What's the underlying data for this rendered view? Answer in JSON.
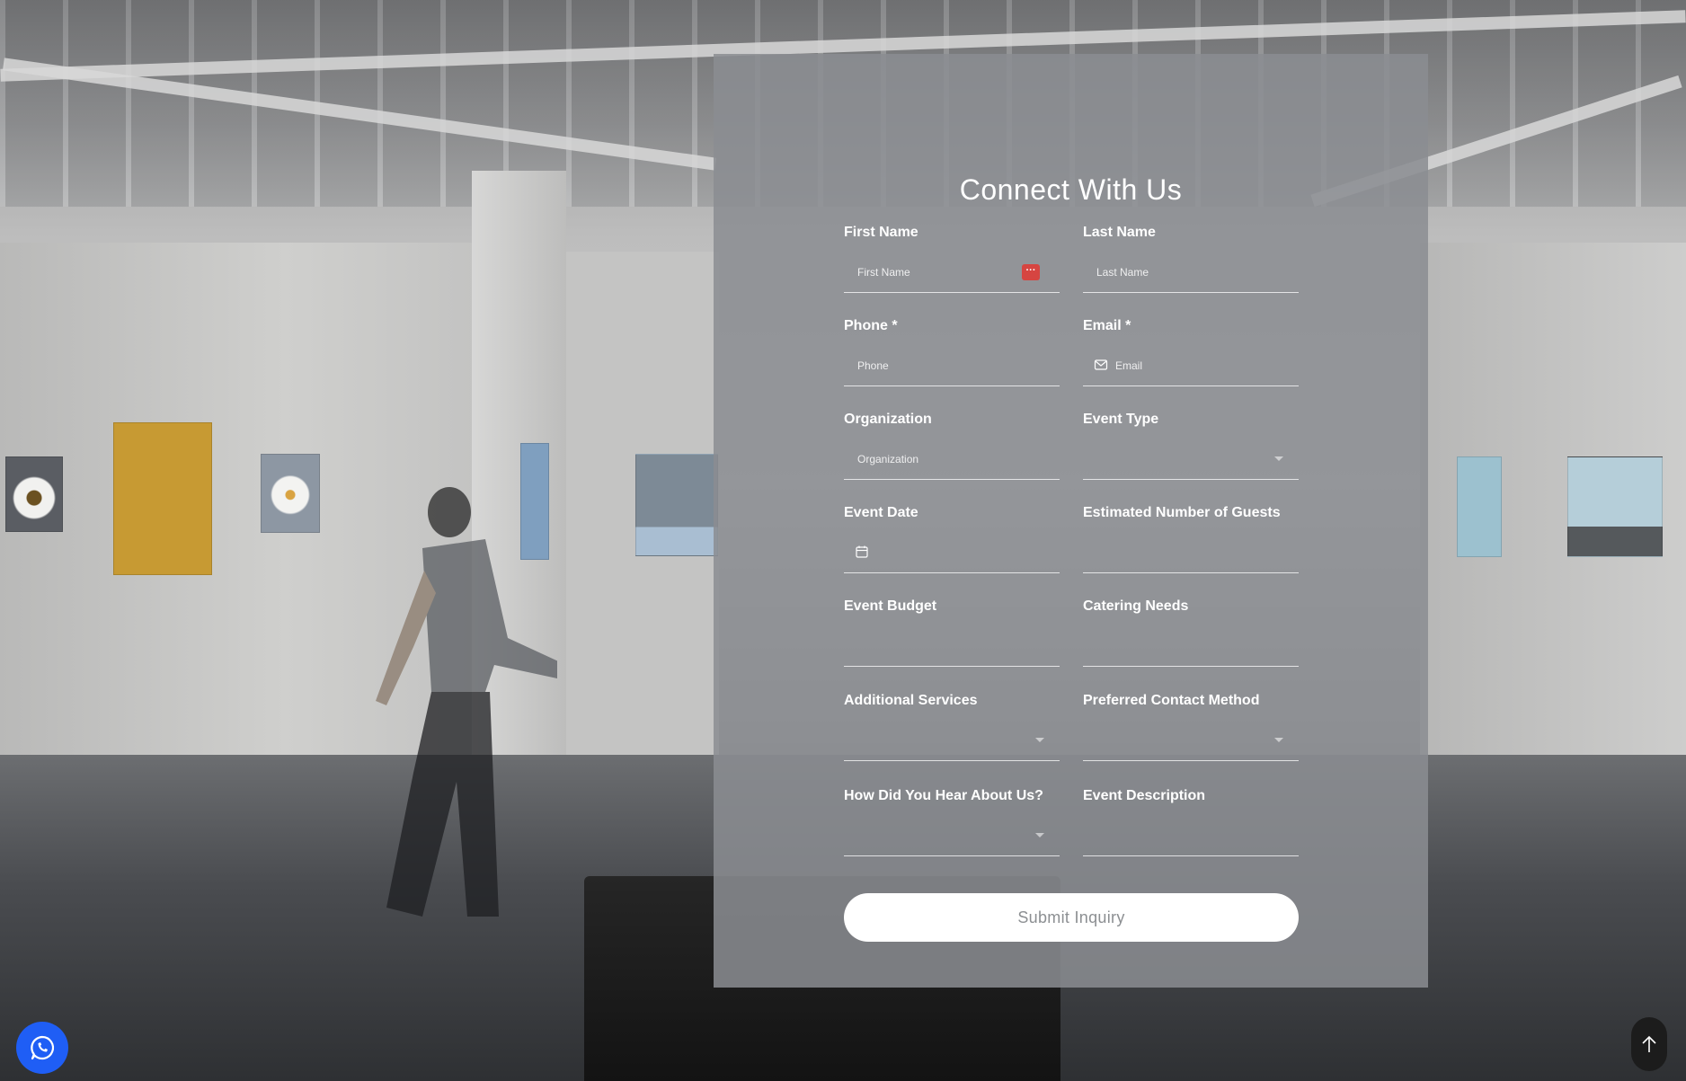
{
  "form": {
    "title": "Connect With Us",
    "fields": {
      "first_name": {
        "label": "First Name",
        "placeholder": "First Name"
      },
      "last_name": {
        "label": "Last Name",
        "placeholder": "Last Name"
      },
      "phone": {
        "label": "Phone *",
        "placeholder": "Phone"
      },
      "email": {
        "label": "Email *",
        "placeholder": "Email",
        "icon": "mail-icon"
      },
      "organization": {
        "label": "Organization",
        "placeholder": "Organization"
      },
      "event_type": {
        "label": "Event Type",
        "icon": "chevron-down-icon"
      },
      "event_date": {
        "label": "Event Date",
        "icon": "calendar-icon"
      },
      "guests": {
        "label": "Estimated Number of Guests"
      },
      "budget": {
        "label": "Event Budget"
      },
      "catering": {
        "label": "Catering Needs"
      },
      "additional_services": {
        "label": "Additional Services",
        "icon": "chevron-down-icon"
      },
      "contact_method": {
        "label": "Preferred Contact Method",
        "icon": "chevron-down-icon"
      },
      "heard_about": {
        "label": "How Did You Hear About Us?",
        "icon": "chevron-down-icon"
      },
      "description": {
        "label": "Event Description"
      }
    },
    "submit_label": "Submit Inquiry"
  },
  "floating": {
    "whatsapp_icon": "whatsapp-icon",
    "whatsapp_color": "#1f5ef5",
    "scroll_top_icon": "arrow-up-icon"
  },
  "colors": {
    "panel": "#8a8d91",
    "text": "#ffffff",
    "button_text": "#8c8f92",
    "password_manager_icon": "#d64541"
  }
}
